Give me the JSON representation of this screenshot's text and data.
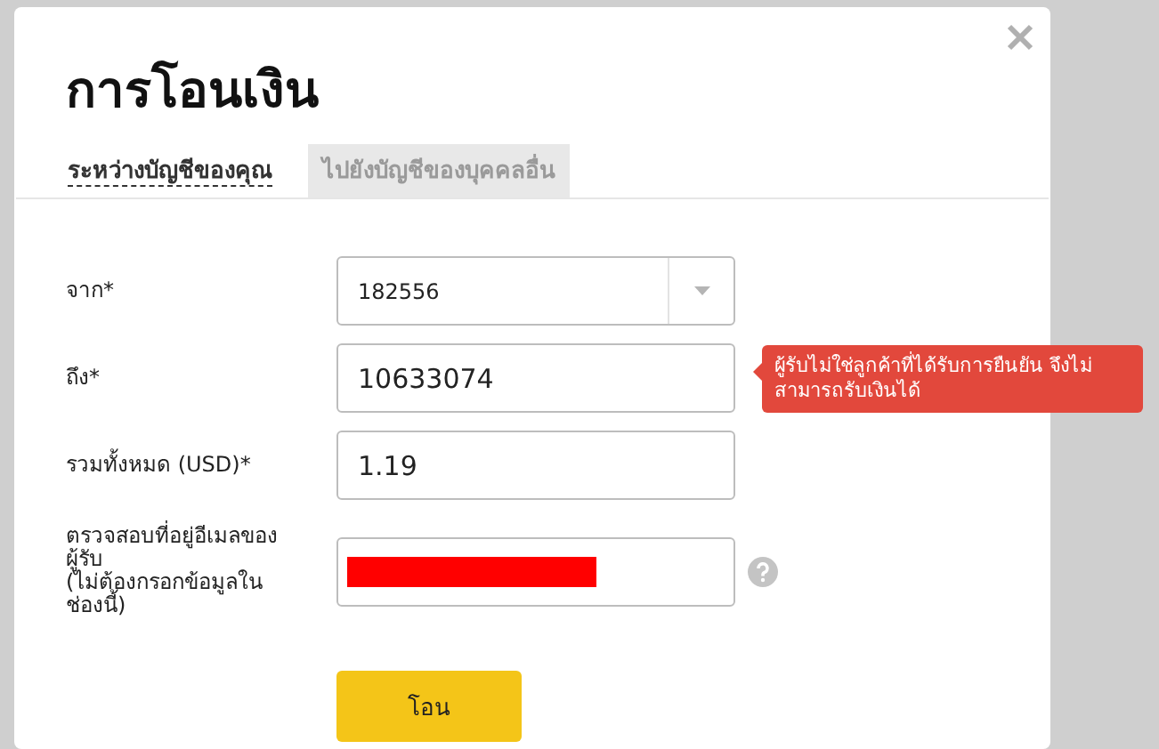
{
  "dialog": {
    "title": "การโอนเงิน"
  },
  "tabs": [
    {
      "label": "ระหว่างบัญชีของคุณ",
      "selected": true
    },
    {
      "label": "ไปยังบัญชีของบุคคลอื่น",
      "selected": false
    }
  ],
  "fields": [
    {
      "kind": "select",
      "label": "จาก*",
      "value": "182556"
    },
    {
      "kind": "text",
      "label": "ถึง*",
      "value": "10633074",
      "error": "ผู้รับไม่ใช่ลูกค้าที่ได้รับการยืนยัน จึงไม่สามารถรับเงินได้"
    },
    {
      "kind": "text",
      "label": "รวมทั้งหมด (USD)*",
      "value": "1.19"
    },
    {
      "kind": "text",
      "label": "ตรวจสอบที่อยู่อีเมลของผู้รับ\n(ไม่ต้องกรอกข้อมูลในช่องนี้)",
      "redacted": true,
      "help": true
    }
  ],
  "submit": {
    "label": "โอน"
  }
}
